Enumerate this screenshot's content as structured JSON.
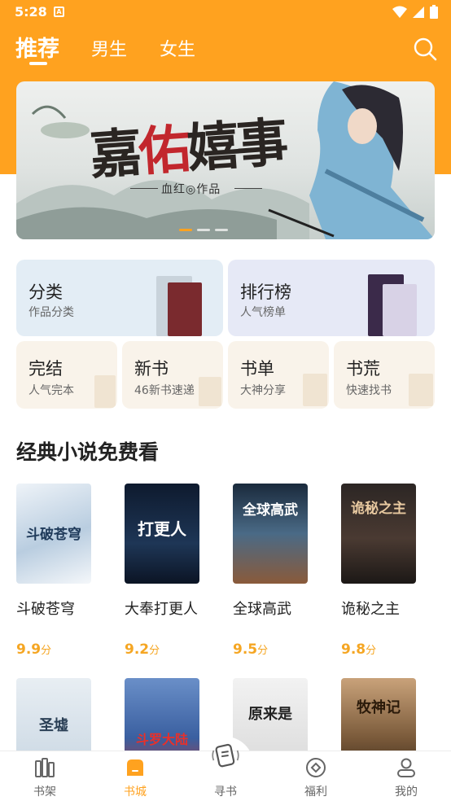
{
  "status_bar": {
    "time": "5:28",
    "app_badge": "A"
  },
  "tabs": [
    {
      "label": "推荐",
      "active": true
    },
    {
      "label": "男生",
      "active": false
    },
    {
      "label": "女生",
      "active": false
    }
  ],
  "banner": {
    "title_black_1": "嘉",
    "title_red": "佑",
    "title_black_2": "嬉事",
    "author": "血红◎作品",
    "slide_count": 3,
    "active_slide": 1
  },
  "quick_entries": {
    "category": {
      "title": "分类",
      "subtitle": "作品分类"
    },
    "ranking": {
      "title": "排行榜",
      "subtitle": "人气榜单"
    },
    "finished": {
      "title": "完结",
      "subtitle": "人气完本"
    },
    "new_books": {
      "title": "新书",
      "subtitle": "46新书速递"
    },
    "book_list": {
      "title": "书单",
      "subtitle": "大神分享"
    },
    "book_hunt": {
      "title": "书荒",
      "subtitle": "快速找书"
    }
  },
  "section": {
    "title": "经典小说免费看"
  },
  "books": [
    {
      "name": "斗破苍穹",
      "score": "9.9",
      "unit": "分",
      "cover_text": "斗破苍穹"
    },
    {
      "name": "大奉打更人",
      "score": "9.2",
      "unit": "分",
      "cover_text": "打更人"
    },
    {
      "name": "全球高武",
      "score": "9.5",
      "unit": "分",
      "cover_text": "全球高武"
    },
    {
      "name": "诡秘之主",
      "score": "9.8",
      "unit": "分",
      "cover_text": "诡秘之主"
    }
  ],
  "books_row2_covers": [
    "圣墟",
    "斗罗大陆",
    "原来是",
    "牧神记"
  ],
  "bottom_nav": [
    {
      "label": "书架",
      "icon": "bookshelf-icon",
      "active": false
    },
    {
      "label": "书城",
      "icon": "bookstore-icon",
      "active": true
    },
    {
      "label": "寻书",
      "icon": "find-book-icon",
      "active": false
    },
    {
      "label": "福利",
      "icon": "welfare-icon",
      "active": false
    },
    {
      "label": "我的",
      "icon": "profile-icon",
      "active": false
    }
  ],
  "colors": {
    "accent": "#ffa21f",
    "score": "#f5a623"
  }
}
